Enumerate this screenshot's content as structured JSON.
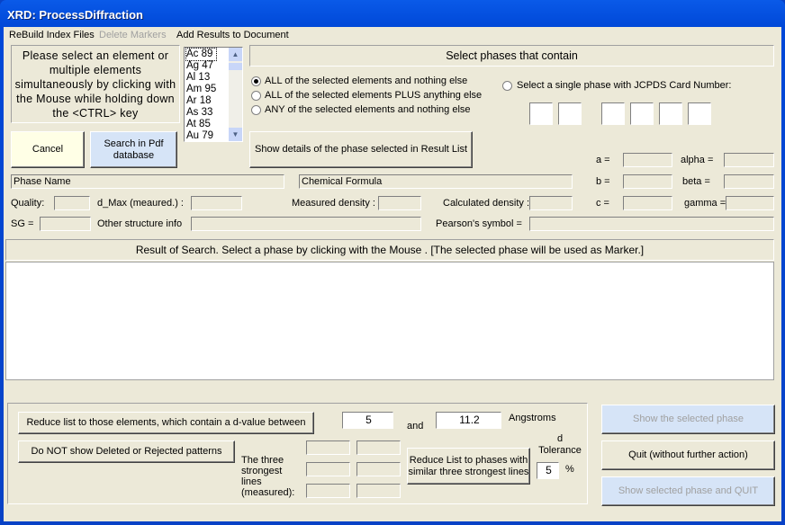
{
  "window": {
    "title": "XRD: ProcessDiffraction"
  },
  "menu": [
    "ReBuild Index Files",
    "Delete Markers",
    "Add Results to Document"
  ],
  "instructions": "Please select an element or multiple elements simultaneously by clicking with the Mouse while holding down the <CTRL> key",
  "elements": [
    "Ac 89",
    "Ag 47",
    "Al 13",
    "Am 95",
    "Ar 18",
    "As 33",
    "At 85",
    "Au 79"
  ],
  "selected_element": "Ac 89",
  "phase_select": {
    "header": "Select phases that contain",
    "options": [
      "ALL of the selected elements and nothing else",
      "ALL of the selected elements PLUS anything else",
      "ANY of the selected elements and nothing else"
    ],
    "selected": 0,
    "jcpds_label": "Select a single phase with JCPDS Card Number:"
  },
  "buttons": {
    "cancel": "Cancel",
    "search": "Search in Pdf database",
    "show_details": "Show details of the phase selected  in Result List",
    "reduce_d": "Reduce list to those elements, which contain a d-value between",
    "do_not_show": "Do NOT show Deleted or Rejected patterns",
    "reduce_three": "Reduce List to phases with similar three strongest lines",
    "show_selected": "Show the selected  phase",
    "quit": "Quit   (without further action)",
    "show_quit": "Show selected phase and QUIT"
  },
  "fields": {
    "phase_name": "Phase Name",
    "chemical_formula": "Chemical Formula"
  },
  "labels": {
    "a": "a =",
    "b": "b =",
    "c": "c =",
    "alpha": "alpha =",
    "beta": "beta =",
    "gamma": "gamma =",
    "quality": "Quality:",
    "dmax": "d_Max (meaured.) :",
    "measured_density": "Measured density :",
    "calculated_density": "Calculated density :",
    "sg": "SG =",
    "other": "Other structure info",
    "pearson": "Pearson's symbol =",
    "and": "and",
    "angstroms": "Angstroms",
    "three_lines": "The three strongest lines (measured):",
    "d_tol": "d Tolerance",
    "percent": "%"
  },
  "result": {
    "header": "Result of Search.   Select a phase by clicking with the Mouse . [The selected phase will be used as Marker.]"
  },
  "inputs": {
    "d_min": "5",
    "d_max": "11.2",
    "tolerance": "5"
  }
}
